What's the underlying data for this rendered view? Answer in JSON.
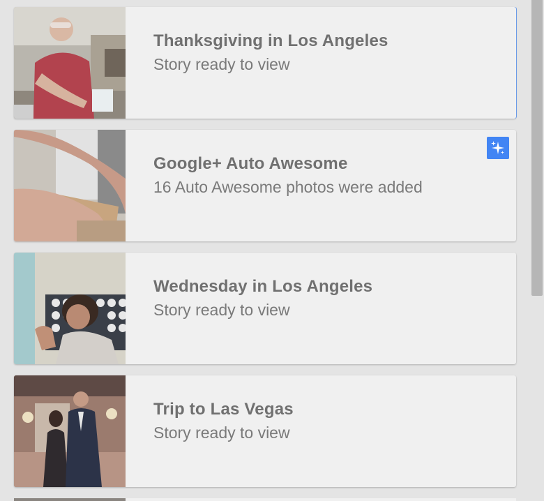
{
  "stories": [
    {
      "title": "Thanksgiving in Los Angeles",
      "subtitle": "Story ready to view",
      "thumbnail": "man-preparing-food-photo",
      "selected": true
    },
    {
      "title": "Google+ Auto Awesome",
      "subtitle": "16 Auto Awesome photos were added",
      "thumbnail": "hands-cutting-box-photo",
      "badge": "sparkle-icon",
      "badge_color": "#4285f4"
    },
    {
      "title": "Wednesday in Los Angeles",
      "subtitle": "Story ready to view",
      "thumbnail": "woman-smiling-photo"
    },
    {
      "title": "Trip to Las Vegas",
      "subtitle": "Story ready to view",
      "thumbnail": "couple-posing-photo"
    }
  ],
  "colors": {
    "background": "#e4e4e4",
    "card": "#f0f0f0",
    "accent": "#4285f4",
    "title_text": "#707070",
    "subtitle_text": "#7a7a7a"
  }
}
